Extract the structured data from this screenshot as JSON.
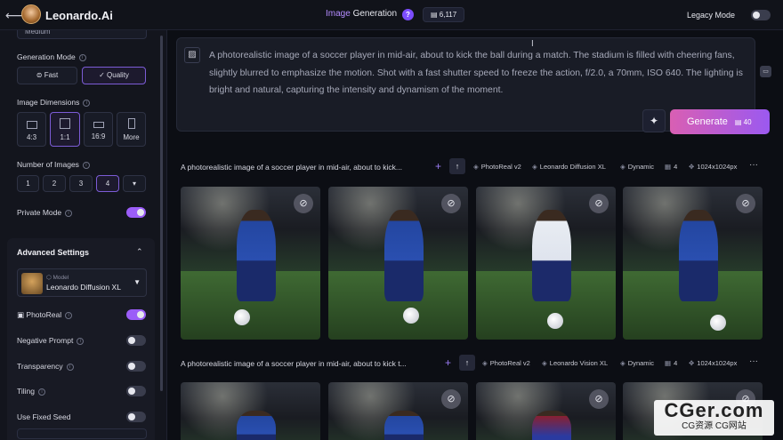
{
  "topbar": {
    "back_icon": "arrow-left-icon",
    "brand": "Leonardo.Ai",
    "title_prefix": "Image",
    "title_suffix": " Generation",
    "help": "?",
    "tokens": "6,117",
    "legacy_label": "Legacy Mode",
    "legacy_on": false
  },
  "sidebar": {
    "preset_value": "Medium",
    "generation_mode": {
      "label": "Generation Mode",
      "options": [
        "Fast",
        "Quality"
      ],
      "selected": "Quality"
    },
    "image_dimensions": {
      "label": "Image Dimensions",
      "options": [
        "4:3",
        "1:1",
        "16:9",
        "More"
      ],
      "selected": "1:1"
    },
    "number_of_images": {
      "label": "Number of Images",
      "options": [
        "1",
        "2",
        "3",
        "4"
      ],
      "selected": "4",
      "more": "▾"
    },
    "private_mode": {
      "label": "Private Mode",
      "on": true
    },
    "advanced": {
      "label": "Advanced Settings",
      "model_caption": "Model",
      "model_name": "Leonardo Diffusion XL",
      "photoreal": {
        "label": "PhotoReal",
        "on": true
      },
      "negative_prompt": {
        "label": "Negative Prompt",
        "on": false
      },
      "transparency": {
        "label": "Transparency",
        "on": false
      },
      "tiling": {
        "label": "Tiling",
        "on": false
      },
      "fixed_seed": {
        "label": "Use Fixed Seed",
        "on": false
      }
    }
  },
  "prompt": {
    "text": "A photorealistic image of a soccer player in mid-air, about to kick the ball during a match. The stadium is filled with cheering fans, slightly blurred to emphasize the motion. Shot with a fast shutter speed to freeze the action, f/2.0, a 70mm, ISO 640. The lighting is bright and natural, capturing the intensity and dynamism of the moment.",
    "generate_label": "Generate",
    "generate_cost": "40"
  },
  "generations": [
    {
      "prompt": "A photorealistic image of a soccer player in mid-air, about to kick...",
      "preset": "PhotoReal v2",
      "model": "Leonardo Diffusion XL",
      "style": "Dynamic",
      "count": "4",
      "size": "1024x1024px"
    },
    {
      "prompt": "A photorealistic image of a soccer player in mid-air, about to kick t...",
      "preset": "PhotoReal v2",
      "model": "Leonardo Vision XL",
      "style": "Dynamic",
      "count": "4",
      "size": "1024x1024px"
    }
  ],
  "watermark": {
    "line1": "CGer.com",
    "line2": "CG资源 CG网站"
  },
  "colors": {
    "accent": "#9b5df8",
    "generate_start": "#d95fb3",
    "generate_end": "#9b59f0"
  }
}
